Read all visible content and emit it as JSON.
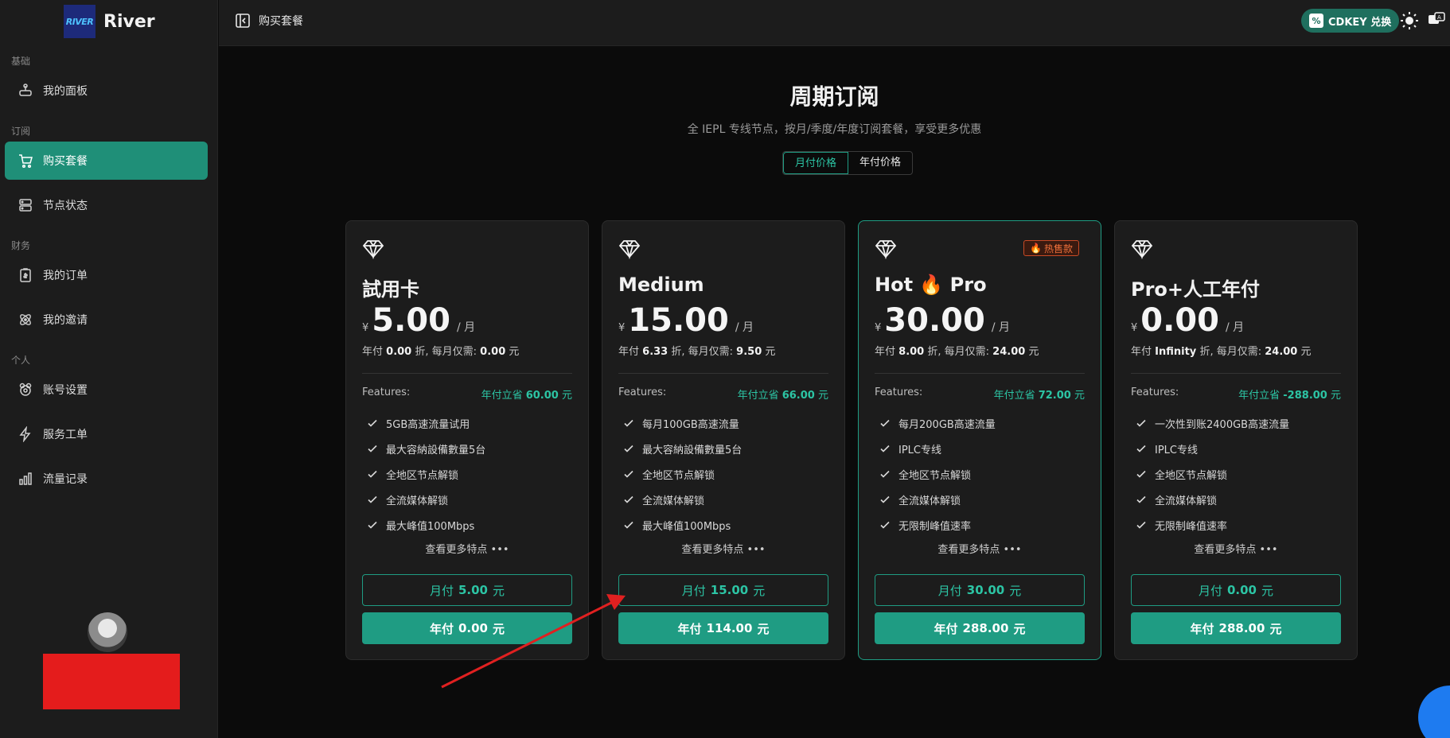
{
  "brand": {
    "logo_text": "RIVER",
    "name": "River"
  },
  "sidebar": {
    "sections": [
      {
        "label": "基础",
        "items": [
          {
            "label": "我的面板",
            "icon": "gamepad-icon"
          }
        ]
      },
      {
        "label": "订阅",
        "items": [
          {
            "label": "购买套餐",
            "icon": "cart-icon",
            "active": true
          },
          {
            "label": "节点状态",
            "icon": "server-icon"
          }
        ]
      },
      {
        "label": "财务",
        "items": [
          {
            "label": "我的订单",
            "icon": "receipt-icon"
          },
          {
            "label": "我的邀请",
            "icon": "atom-icon"
          }
        ]
      },
      {
        "label": "个人",
        "items": [
          {
            "label": "账号设置",
            "icon": "settings-icon"
          },
          {
            "label": "服务工单",
            "icon": "bolt-icon"
          },
          {
            "label": "流量记录",
            "icon": "chart-icon"
          }
        ]
      }
    ]
  },
  "header": {
    "title": "购买套餐",
    "cdkey_label": "CDKEY 兑换"
  },
  "main": {
    "title": "周期订阅",
    "subtitle": "全 IEPL 专线节点，按月/季度/年度订阅套餐，享受更多优惠",
    "toggle": {
      "monthly": "月付价格",
      "yearly": "年付价格"
    }
  },
  "common": {
    "currency": "¥",
    "per": "/ 月",
    "features_label": "Features:",
    "more_label": "查看更多特点 •••",
    "yuan": "元",
    "monthly_prefix": "月付",
    "yearly_prefix": "年付",
    "annual_prefix": "年付",
    "discount_word": "折, 每月仅需:",
    "save_prefix": "年付立省"
  },
  "plans": [
    {
      "name": "試用卡",
      "price": "5.00",
      "annual_discount": "0.00",
      "monthly_equiv": "0.00",
      "save": "60.00",
      "features": [
        "5GB高速流量试用",
        "最大容納設備數量5台",
        "全地区节点解锁",
        "全流媒体解锁",
        "最大峰值100Mbps"
      ],
      "monthly_btn": "5.00",
      "yearly_btn": "0.00"
    },
    {
      "name": "Medium",
      "price": "15.00",
      "annual_discount": "6.33",
      "monthly_equiv": "9.50",
      "save": "66.00",
      "features": [
        "每月100GB高速流量",
        "最大容納設備數量5台",
        "全地区节点解锁",
        "全流媒体解锁",
        "最大峰值100Mbps"
      ],
      "monthly_btn": "15.00",
      "yearly_btn": "114.00"
    },
    {
      "name": "Hot 🔥 Pro",
      "price": "30.00",
      "annual_discount": "8.00",
      "monthly_equiv": "24.00",
      "save": "72.00",
      "badge": "热售款",
      "features": [
        "每月200GB高速流量",
        "IPLC专线",
        "全地区节点解锁",
        "全流媒体解锁",
        "无限制峰值速率"
      ],
      "monthly_btn": "30.00",
      "yearly_btn": "288.00"
    },
    {
      "name": "Pro+人工年付",
      "price": "0.00",
      "annual_discount": "Infinity",
      "monthly_equiv": "24.00",
      "save": "-288.00",
      "features": [
        "一次性到账2400GB高速流量",
        "IPLC专线",
        "全地区节点解锁",
        "全流媒体解锁",
        "无限制峰值速率"
      ],
      "monthly_btn": "0.00",
      "yearly_btn": "288.00"
    }
  ],
  "colors": {
    "accent": "#1f9c83",
    "sidebar_bg": "#1c1c1c",
    "page_bg": "#0b0b0b",
    "hot": "#f0703a",
    "annotation_arrow": "#e02020",
    "redaction": "#e41c1c"
  }
}
